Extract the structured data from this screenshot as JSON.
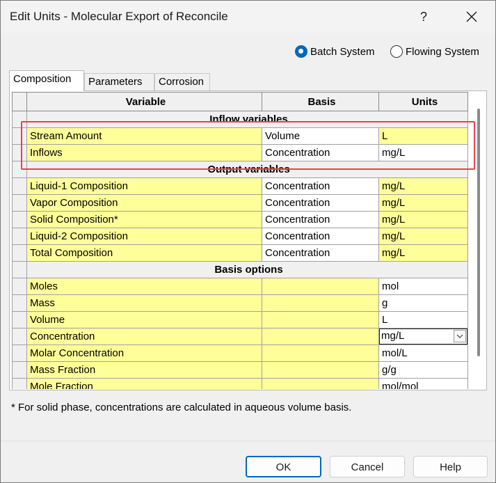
{
  "window": {
    "title": "Edit Units - Molecular Export of Reconcile",
    "help_glyph": "?",
    "close_icon": "close-icon"
  },
  "system": {
    "options": [
      {
        "label": "Batch System",
        "selected": true
      },
      {
        "label": "Flowing System",
        "selected": false
      }
    ]
  },
  "tabs": [
    {
      "label": "Composition",
      "active": true
    },
    {
      "label": "Parameters",
      "active": false
    },
    {
      "label": "Corrosion",
      "active": false
    }
  ],
  "grid": {
    "headers": [
      "Variable",
      "Basis",
      "Units"
    ],
    "sections": {
      "inflow": "Inflow variables",
      "output": "Output variables",
      "basis": "Basis options"
    },
    "inflow_rows": [
      {
        "variable": "Stream Amount",
        "basis": "Volume",
        "units": "L"
      },
      {
        "variable": "Inflows",
        "basis": "Concentration",
        "units": "mg/L"
      }
    ],
    "output_rows": [
      {
        "variable": "Liquid-1 Composition",
        "basis": "Concentration",
        "units": "mg/L"
      },
      {
        "variable": "Vapor Composition",
        "basis": "Concentration",
        "units": "mg/L"
      },
      {
        "variable": "Solid Composition*",
        "basis": "Concentration",
        "units": "mg/L"
      },
      {
        "variable": "Liquid-2 Composition",
        "basis": "Concentration",
        "units": "mg/L"
      },
      {
        "variable": "Total Composition",
        "basis": "Concentration",
        "units": "mg/L"
      }
    ],
    "basis_rows": [
      {
        "variable": "Moles",
        "basis": "",
        "units": "mol"
      },
      {
        "variable": "Mass",
        "basis": "",
        "units": "g"
      },
      {
        "variable": "Volume",
        "basis": "",
        "units": "L"
      },
      {
        "variable": "Concentration",
        "basis": "",
        "units": "mg/L",
        "dropdown": true
      },
      {
        "variable": "Molar Concentration",
        "basis": "",
        "units": "mol/L"
      },
      {
        "variable": "Mass Fraction",
        "basis": "",
        "units": "g/g"
      },
      {
        "variable": "Mole Fraction",
        "basis": "",
        "units": "mol/mol"
      }
    ]
  },
  "footnote": "* For solid phase, concentrations are calculated in aqueous volume basis.",
  "buttons": {
    "ok": "OK",
    "cancel": "Cancel",
    "help": "Help"
  },
  "colors": {
    "editable_cell": "#ffff99",
    "accent": "#0067c0",
    "highlight_box": "#e8414f"
  }
}
